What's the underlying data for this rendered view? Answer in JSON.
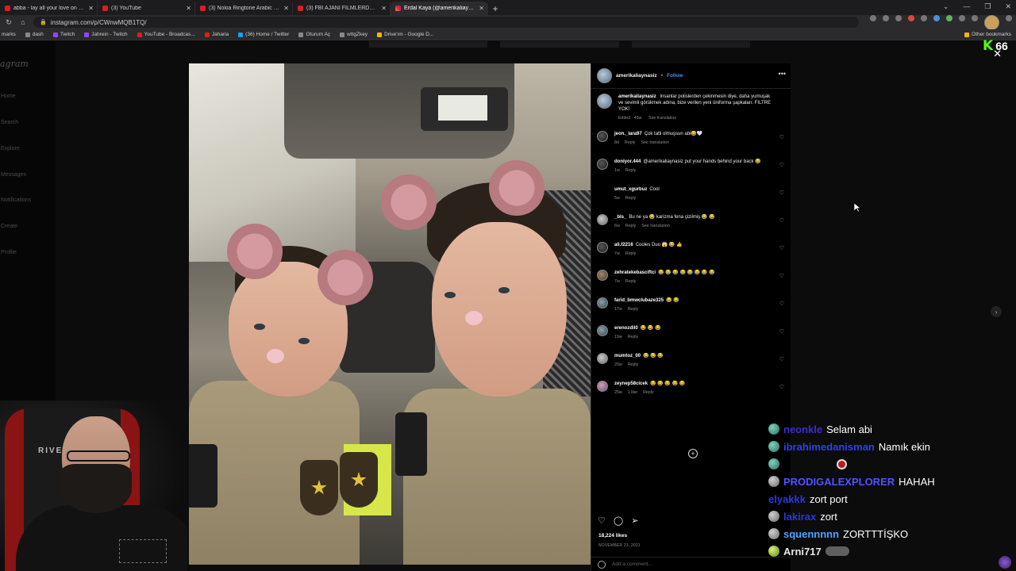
{
  "browser": {
    "tabs": [
      {
        "label": "abba - lay all your love on me",
        "favicon": "yt",
        "active": false
      },
      {
        "label": "(3) YouTube",
        "favicon": "yt",
        "active": false
      },
      {
        "label": "(3) Nokia Ringtone Arabic 1 Hou",
        "favicon": "yt",
        "active": false
      },
      {
        "label": "(3) FBI AJANI FILMLERDEKI FBI S",
        "favicon": "yt",
        "active": false
      },
      {
        "label": "Erdal Kaya (@amerikaliaynasiz) -",
        "favicon": "ig",
        "active": true
      }
    ],
    "url": "instagram.com/p/CWnwMQB1TQ/",
    "bookmarks": [
      {
        "label": "marks",
        "icon": "generic"
      },
      {
        "label": "dash",
        "icon": "generic"
      },
      {
        "label": "Twitch",
        "icon": "twitch"
      },
      {
        "label": "Jahrein - Twitch",
        "icon": "twitch"
      },
      {
        "label": "YouTube - Broadcas...",
        "icon": "youtube"
      },
      {
        "label": "Jaharia",
        "icon": "generic"
      },
      {
        "label": "(36) Home / Twitter",
        "icon": "twitter"
      },
      {
        "label": "Oturum Aç",
        "icon": "generic"
      },
      {
        "label": "wttgZkey",
        "icon": "generic"
      },
      {
        "label": "Drive'ım - Google D...",
        "icon": "drive"
      }
    ],
    "other_bookmarks": "Other bookmarks"
  },
  "sidebar": {
    "logo": "agram",
    "items": [
      "Home",
      "Search",
      "Explore",
      "Messages",
      "Notifications",
      "Create",
      "Profile"
    ]
  },
  "post": {
    "author": "amerikaliaynasiz",
    "follow": "Follow",
    "caption_author": "amerikaliaynasiz",
    "caption": "Insanlar polislerden çekinmesin diye, daha yumuşak ve sevimli görükmek adına, bize verilen yeni üniforma şapkaları. FILTRE YOK!",
    "caption_meta": [
      "Edited · 49w",
      "See translation"
    ],
    "comments": [
      {
        "user": "jeon._lara97",
        "text": "Çok tatli olmuşsun abi😅🤍",
        "meta": [
          "8d",
          "Reply",
          "See translation"
        ]
      },
      {
        "user": "doniyor.444",
        "text": "@amerikaliaynasiz put your hands behind your back 😂",
        "meta": [
          "1w",
          "Reply"
        ]
      },
      {
        "user": "umut_xgurbuz",
        "text": "Cool",
        "meta": [
          "5w",
          "Reply"
        ]
      },
      {
        "user": "_bls_",
        "text": "Bu ne ya 😂 karizma fena çizilmiş 😂 😂",
        "meta": [
          "6w",
          "Reply",
          "See translation"
        ]
      },
      {
        "user": "ali.f2216",
        "text": "Cooles Duo 😱 😂 👍",
        "meta": [
          "7w",
          "Reply"
        ]
      },
      {
        "user": "zehratekebasciftci",
        "text": "😂 😂 😂 😂 😂 😂 😂 😂",
        "meta": [
          "7w",
          "Reply"
        ]
      },
      {
        "user": "farid_bmwclubaze325",
        "text": "😂 😂",
        "meta": [
          "17w",
          "Reply"
        ]
      },
      {
        "user": "erenozdil0",
        "text": "😂 😂 😂",
        "meta": [
          "19w",
          "Reply"
        ]
      },
      {
        "user": "mumtoz_00",
        "text": "😂 😂 😂",
        "meta": [
          "20w",
          "Reply"
        ]
      },
      {
        "user": "zeynep58cicek",
        "text": "😂 😂 😂 😂 😂",
        "meta": [
          "25w",
          "1 like",
          "Reply"
        ]
      }
    ],
    "likes": "18,224 likes",
    "date": "NOVEMBER 23, 2021",
    "add_comment_placeholder": "Add a comment..."
  },
  "overlay": {
    "kick_viewers": "66",
    "chat": [
      {
        "user": "neonkle",
        "message": "Selam abi",
        "name_color": "#3b2bd9",
        "badge": "teal"
      },
      {
        "user": "ibrahimedanisman",
        "message": "Namık ekin",
        "name_color": "#2f3ff0",
        "badge": "teal"
      },
      {
        "user": "",
        "message": "",
        "name_color": "#2f3ff0",
        "badge": "teal"
      },
      {
        "user": "PRODIGALEXPLORER",
        "message": "HAHAH",
        "name_color": "#4a55ff",
        "badge": "gray"
      },
      {
        "user": "elyakkk",
        "message": "zort port",
        "name_color": "#2a35e6",
        "badge": "none"
      },
      {
        "user": "lakirax",
        "message": "zort",
        "name_color": "#2a35e6",
        "badge": "gray"
      },
      {
        "user": "squennnnn",
        "message": "ZORTTTİŞKO",
        "name_color": "#4da3ff",
        "badge": "gray"
      },
      {
        "user": "Arni717",
        "message": "",
        "name_color": "#e8e8e8",
        "badge": "lime"
      }
    ]
  }
}
